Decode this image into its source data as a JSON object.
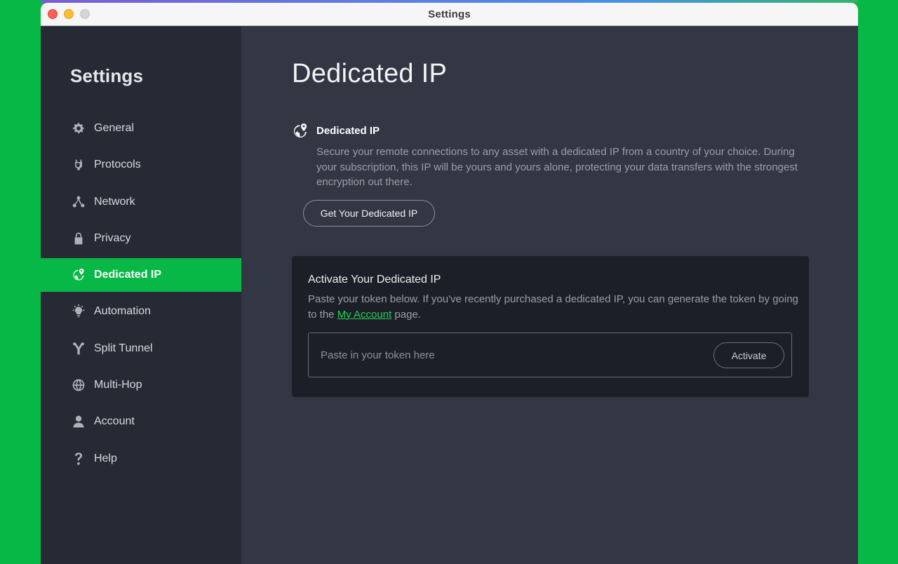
{
  "window": {
    "title": "Settings"
  },
  "sidebar": {
    "heading": "Settings",
    "items": [
      {
        "label": "General",
        "icon": "gear-icon"
      },
      {
        "label": "Protocols",
        "icon": "protocols-icon"
      },
      {
        "label": "Network",
        "icon": "network-icon"
      },
      {
        "label": "Privacy",
        "icon": "lock-icon"
      },
      {
        "label": "Dedicated IP",
        "icon": "dedicated-ip-icon",
        "active": true
      },
      {
        "label": "Automation",
        "icon": "lightbulb-icon"
      },
      {
        "label": "Split Tunnel",
        "icon": "split-tunnel-icon"
      },
      {
        "label": "Multi-Hop",
        "icon": "globe-icon"
      },
      {
        "label": "Account",
        "icon": "user-icon"
      },
      {
        "label": "Help",
        "icon": "question-icon"
      }
    ]
  },
  "main": {
    "title": "Dedicated IP",
    "feature": {
      "heading": "Dedicated IP",
      "description": "Secure your remote connections to any asset with a dedicated IP from a country of your choice. During your subscription, this IP will be yours and yours alone, protecting your data transfers with the strongest encryption out there.",
      "button": "Get Your Dedicated IP"
    },
    "activate": {
      "heading": "Activate Your Dedicated IP",
      "text_before": "Paste your token below. If you've recently purchased a dedicated IP, you can generate the token by going to the ",
      "link": "My Account",
      "text_after": " page.",
      "placeholder": "Paste in your token here",
      "button": "Activate"
    }
  },
  "colors": {
    "accent": "#08b846",
    "sidebar_bg": "#262a35",
    "main_bg": "#333743",
    "card_bg": "#1c1f27",
    "link": "#1fd25a"
  }
}
